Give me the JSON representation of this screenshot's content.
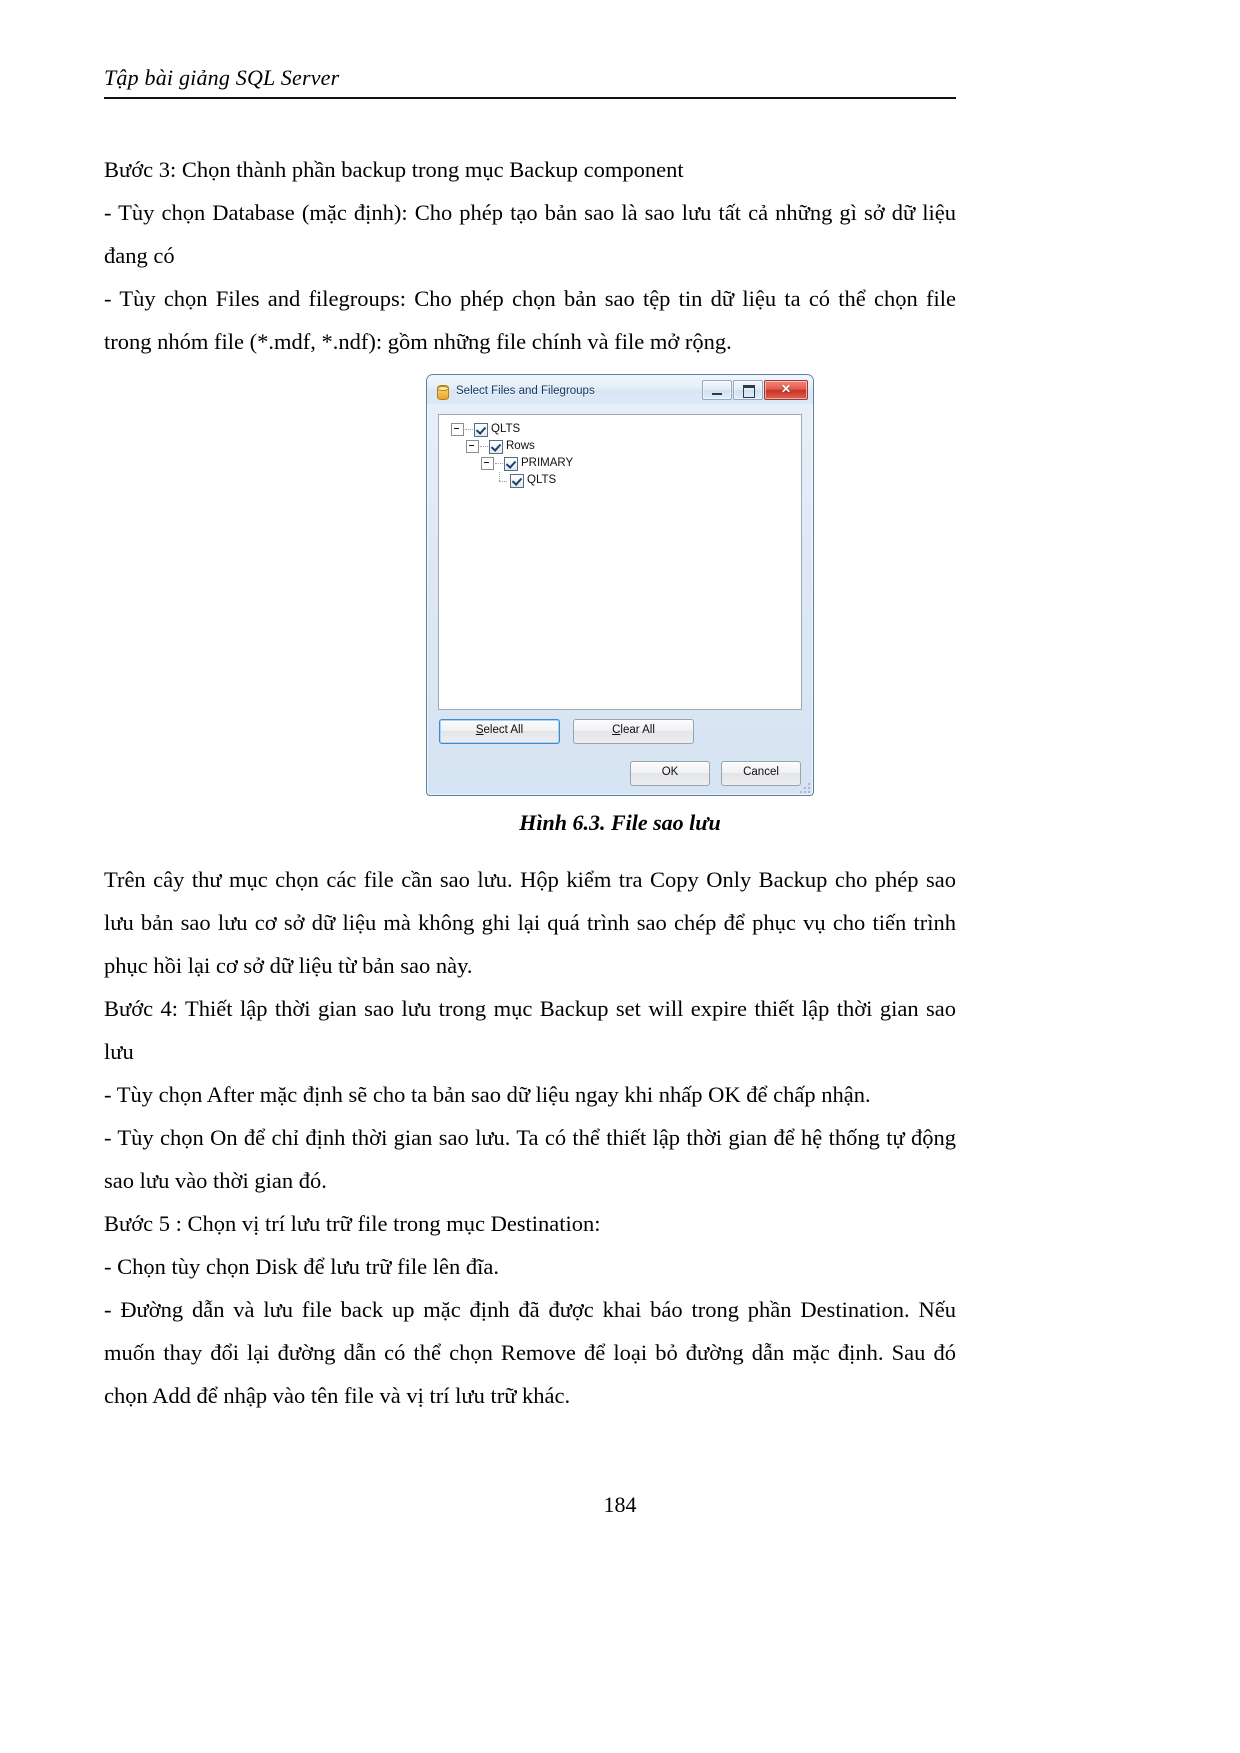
{
  "header": {
    "running_title": "Tập bài giảng SQL Server"
  },
  "body_top": {
    "p1": "Bước 3: Chọn thành phần backup trong mục Backup component",
    "p2": "- Tùy chọn Database (mặc định): Cho phép tạo bản sao là sao lưu tất cả những gì sở dữ liệu đang có",
    "p3": "- Tùy chọn Files and filegroups: Cho phép chọn bản sao tệp tin dữ liệu ta có thể chọn file trong nhóm file (*.mdf, *.ndf): gồm những file chính và file mở rộng."
  },
  "dialog": {
    "title": "Select Files and Filegroups",
    "icon": "database-cylinder-icon",
    "window_controls": {
      "minimize": "minimize-icon",
      "maximize": "maximize-icon",
      "close": "✕"
    },
    "tree": [
      {
        "level": 0,
        "label": "QLTS",
        "checked": true,
        "expander": "collapse",
        "connector": "expander"
      },
      {
        "level": 1,
        "label": "Rows",
        "checked": true,
        "expander": "collapse",
        "connector": "expander"
      },
      {
        "level": 2,
        "label": "PRIMARY",
        "checked": true,
        "expander": "collapse",
        "connector": "expander"
      },
      {
        "level": 3,
        "label": "QLTS",
        "checked": true,
        "expander": "none",
        "connector": "elbow"
      }
    ],
    "buttons": {
      "select_all": "Select All",
      "select_all_accel": "S",
      "clear_all": "Clear All",
      "clear_all_accel": "C",
      "ok": "OK",
      "cancel": "Cancel"
    }
  },
  "figure": {
    "caption": "Hình 6.3. File sao lưu"
  },
  "body_bottom": {
    "p1": "Trên cây thư mục chọn các file cần sao lưu. Hộp kiểm tra Copy Only Backup cho phép sao lưu bản sao lưu cơ sở dữ liệu mà không ghi lại quá trình sao chép để phục vụ cho tiến trình phục hồi lại cơ sở dữ liệu từ bản sao này.",
    "p2": "Bước 4: Thiết lập thời gian sao lưu trong mục Backup set will expire thiết lập thời gian sao lưu",
    "p3": "- Tùy chọn After  mặc định sẽ cho ta bản sao dữ liệu ngay khi nhấp OK để chấp nhận.",
    "p4": "- Tùy chọn On để chỉ định thời gian sao lưu. Ta có thể thiết lập thời gian để hệ thống tự động sao lưu vào thời gian đó.",
    "p5": "Bước 5 : Chọn vị trí lưu trữ file trong mục Destination:",
    "p6": "- Chọn tùy chọn Disk để lưu trữ file lên đĩa.",
    "p7": "- Đường dẫn và lưu file back up mặc định đã được khai báo trong phần Destination. Nếu muốn thay đổi lại đường dẫn có thể chọn Remove để loại bỏ đường dẫn mặc định. Sau đó chọn Add để nhập vào tên file và vị trí lưu trữ khác."
  },
  "footer": {
    "page_number": "184"
  }
}
